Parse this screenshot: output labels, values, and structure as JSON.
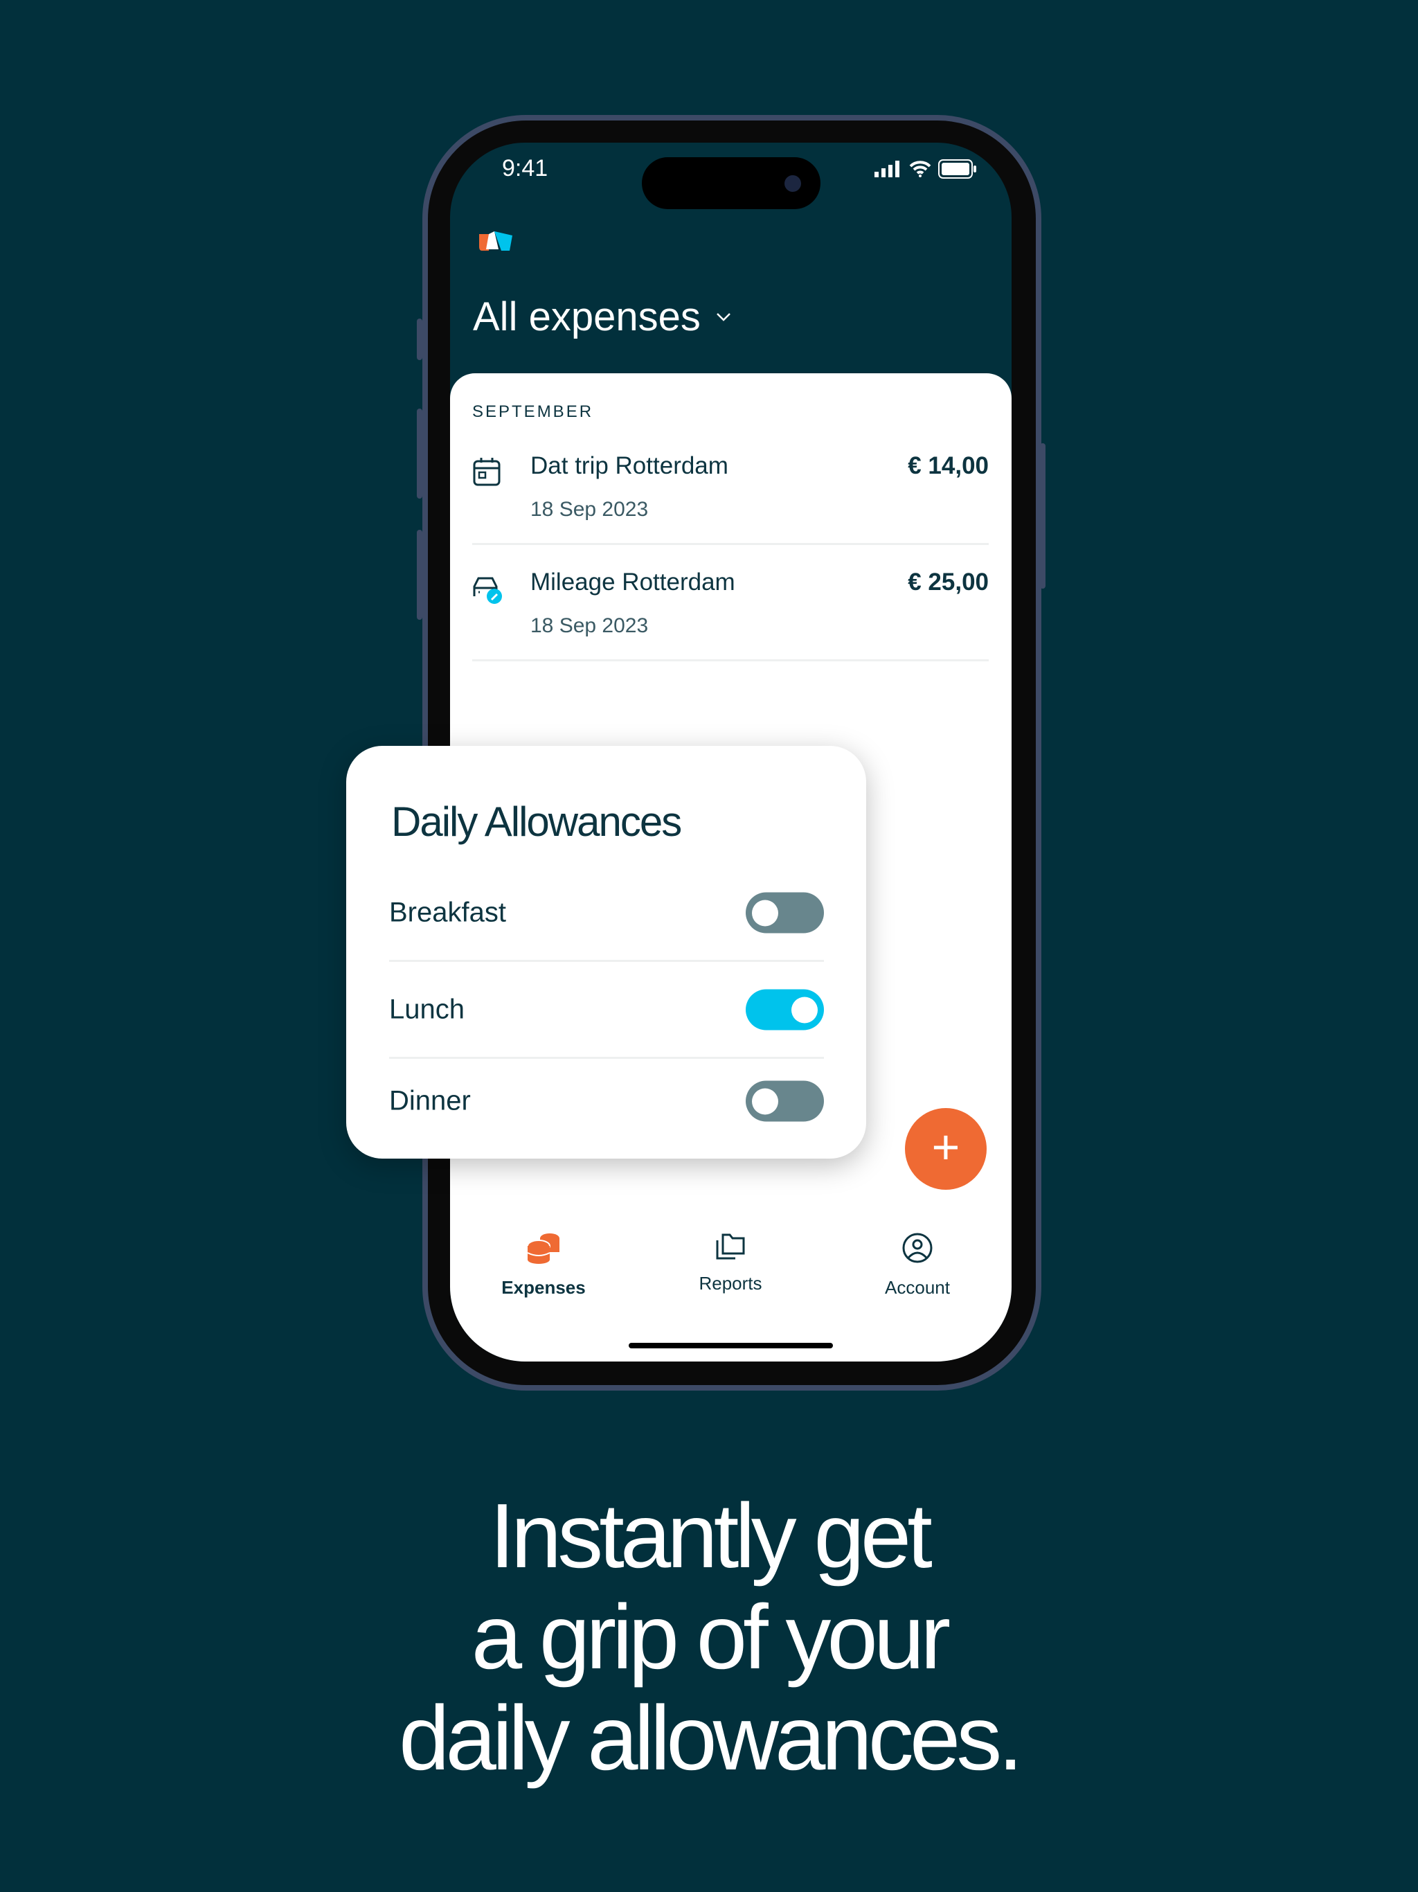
{
  "status": {
    "time": "9:41"
  },
  "header": {
    "title": "All expenses"
  },
  "list": {
    "month": "SEPTEMBER",
    "items": [
      {
        "icon": "calendar-icon",
        "name": "Dat trip Rotterdam",
        "date": "18 Sep 2023",
        "amount": "€ 14,00"
      },
      {
        "icon": "car-edit-icon",
        "name": "Mileage Rotterdam",
        "date": "18 Sep 2023",
        "amount": "€ 25,00"
      }
    ]
  },
  "card": {
    "title": "Daily Allowances",
    "toggles": [
      {
        "label": "Breakfast",
        "on": false
      },
      {
        "label": "Lunch",
        "on": true
      },
      {
        "label": "Dinner",
        "on": false
      }
    ]
  },
  "fab": {
    "label": "+"
  },
  "nav": [
    {
      "label": "Expenses",
      "icon": "coins-icon",
      "active": true
    },
    {
      "label": "Reports",
      "icon": "folders-icon"
    },
    {
      "label": "Account",
      "icon": "user-circle-icon"
    }
  ],
  "tagline": {
    "line1": "Instantly get",
    "line2": "a grip of your",
    "line3": "daily allowances."
  },
  "colors": {
    "background": "#02303c",
    "accent": "#ef6a33",
    "toggle_on": "#00c3ec",
    "toggle_off": "#68868d"
  }
}
